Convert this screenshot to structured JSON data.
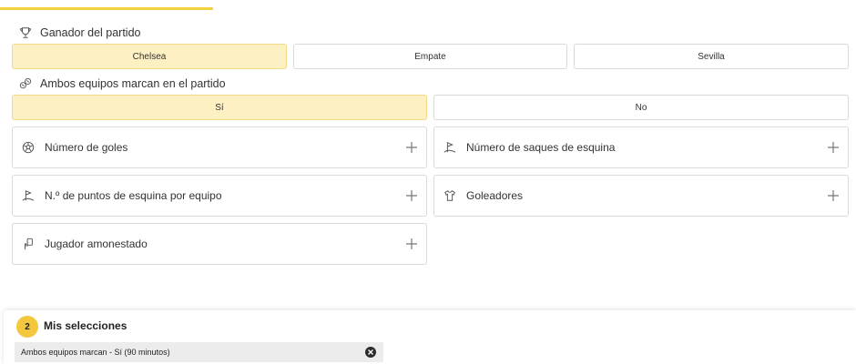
{
  "markets": {
    "winner": {
      "title": "Ganador del partido",
      "icon": "trophy-icon",
      "options": [
        "Chelsea",
        "Empate",
        "Sevilla"
      ],
      "selected": "Chelsea"
    },
    "btts": {
      "title": "Ambos equipos marcan en el partido",
      "icon": "balls-icon",
      "options": [
        "Sí",
        "No"
      ],
      "selected": "Sí"
    },
    "accordions": [
      {
        "label": "Número de goles",
        "icon": "soccer-ball-icon"
      },
      {
        "label": "Número de saques de esquina",
        "icon": "corner-flag-icon"
      },
      {
        "label": "N.º de puntos de esquina por equipo",
        "icon": "corner-flag-icon"
      },
      {
        "label": "Goleadores",
        "icon": "shirt-icon"
      },
      {
        "label": "Jugador amonestado",
        "icon": "card-icon"
      }
    ]
  },
  "selections": {
    "count": "2",
    "title": "Mis selecciones",
    "items": [
      "Ambos equipos marcan - Sí (90 minutos)"
    ]
  },
  "colors": {
    "accent": "#f3d23f",
    "selected_bg": "#fdf1c4",
    "badge": "#f3c83f"
  }
}
